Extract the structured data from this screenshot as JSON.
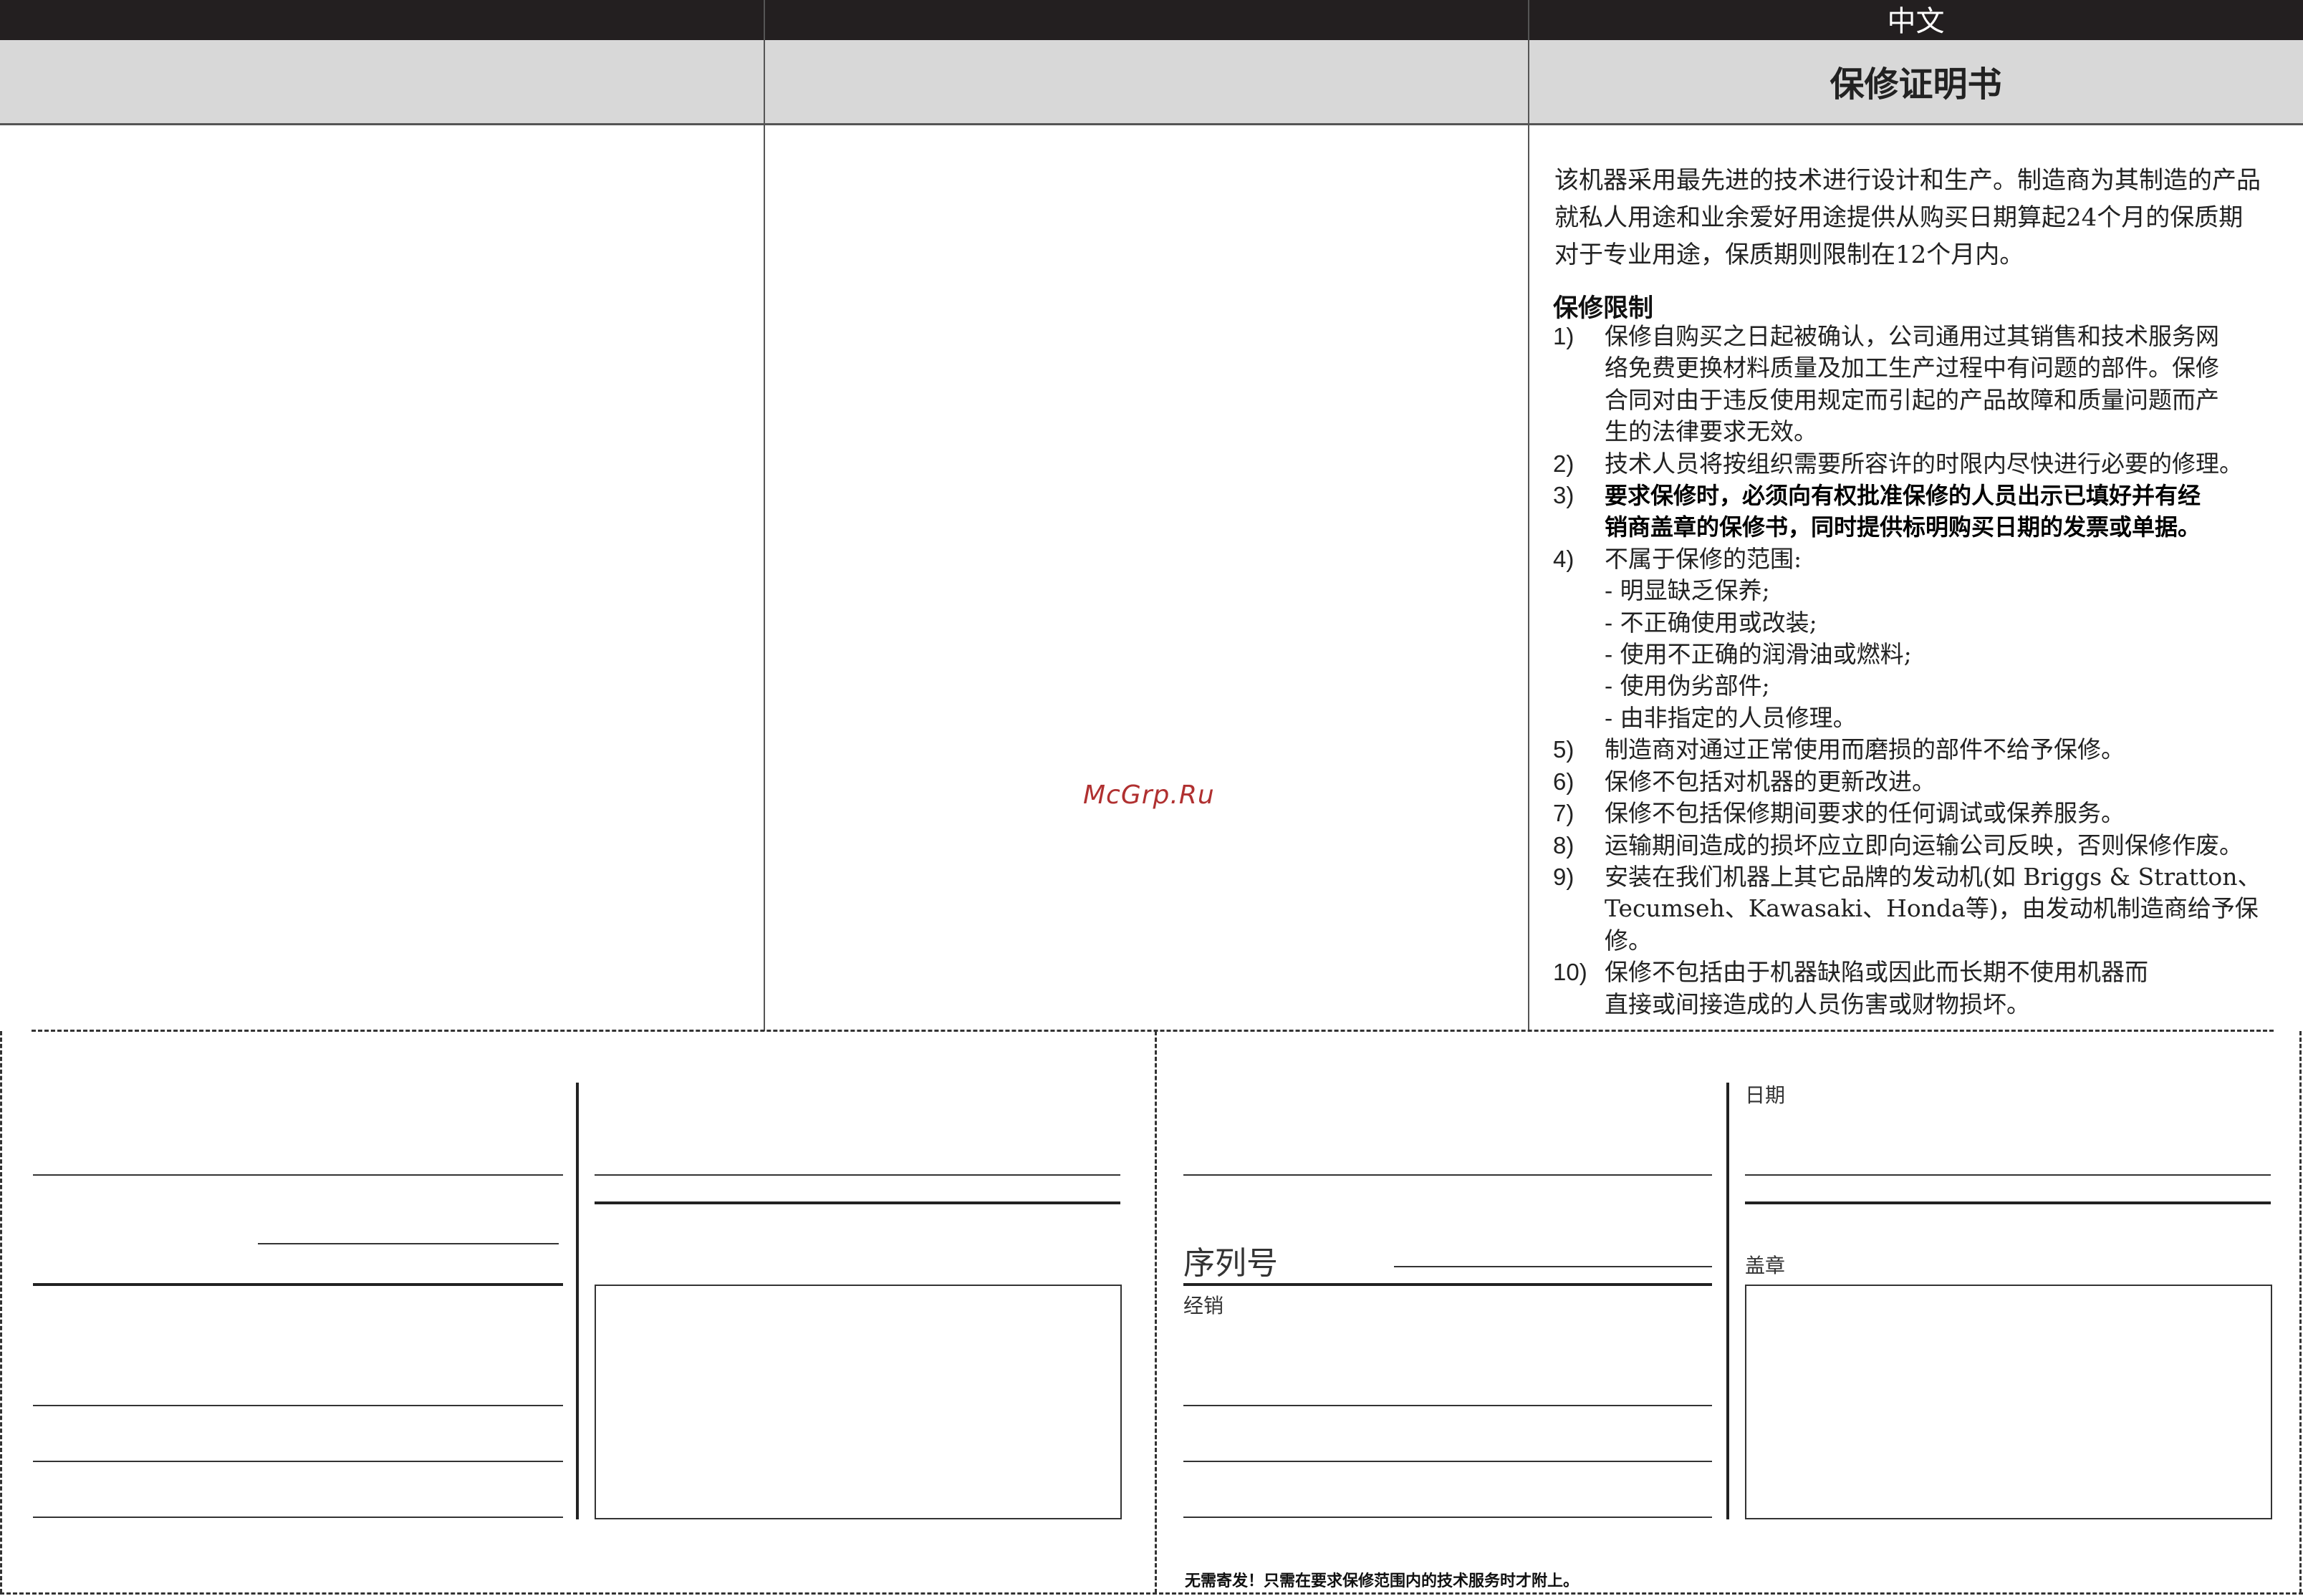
{
  "header": {
    "language": "中文",
    "title": "保修证明书"
  },
  "intro": [
    "该机器采用最先进的技术进行设计和生产。制造商为其制造的产品",
    "就私人用途和业余爱好用途提供从购买日期算起24个月的保质期",
    "对于专业用途，保质期则限制在12个月内。"
  ],
  "limits": {
    "heading": "保修限制",
    "items": [
      {
        "num": "1)",
        "lines": [
          "保修自购买之日起被确认，公司通用过其销售和技术服务网",
          "络免费更换材料质量及加工生产过程中有问题的部件。保修",
          "合同对由于违反使用规定而引起的产品故障和质量问题而产",
          "生的法律要求无效。"
        ]
      },
      {
        "num": "2)",
        "lines": [
          "技术人员将按组织需要所容许的时限内尽快进行必要的修理。"
        ]
      },
      {
        "num": "3)",
        "lines": [
          "要求保修时，必须向有权批准保修的人员出示已填好并有经",
          "销商盖章的保修书，同时提供标明购买日期的发票或单据。"
        ]
      },
      {
        "num": "4)",
        "lines": [
          "不属于保修的范围:"
        ]
      },
      {
        "num": "5)",
        "lines": [
          "制造商对通过正常使用而磨损的部件不给予保修。"
        ]
      },
      {
        "num": "6)",
        "lines": [
          "保修不包括对机器的更新改进。"
        ]
      },
      {
        "num": "7)",
        "lines": [
          "保修不包括保修期间要求的任何调试或保养服务。"
        ]
      },
      {
        "num": "8)",
        "lines": [
          "运输期间造成的损坏应立即向运输公司反映，否则保修作废。"
        ]
      },
      {
        "num": "9)",
        "lines": [
          "安装在我们机器上其它品牌的发动机(如 Briggs & Stratton、",
          "Tecumseh、Kawasaki、Honda等)，由发动机制造商给予保修。"
        ]
      },
      {
        "num": "10)",
        "lines": [
          "保修不包括由于机器缺陷或因此而长期不使用机器而",
          "直接或间接造成的人员伤害或财物损坏。"
        ]
      }
    ],
    "exclusions": [
      "- 明显缺乏保养;",
      "- 不正确使用或改装;",
      "- 使用不正确的润滑油或燃料;",
      "- 使用伪劣部件;",
      "- 由非指定的人员修理。"
    ]
  },
  "watermark": "McGrp.Ru",
  "form": {
    "serial_label": "序列号",
    "label_a": "经销",
    "label_b": "日期",
    "label_c": "盖章",
    "footnote": "无需寄发！只需在要求保修范围内的技术服务时才附上。"
  }
}
